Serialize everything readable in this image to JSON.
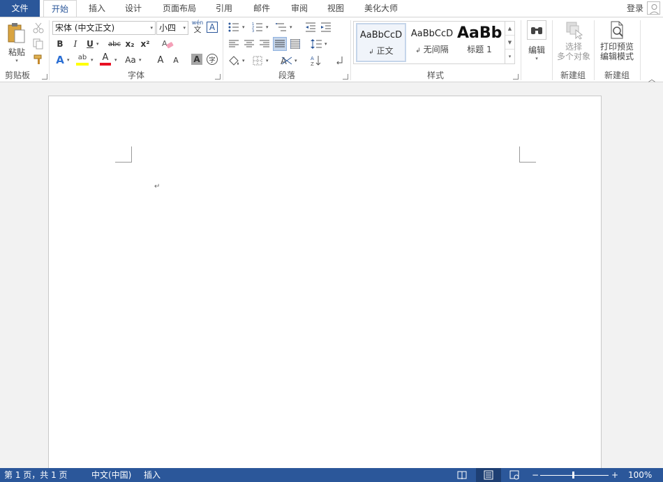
{
  "tabs": {
    "file": "文件",
    "home": "开始",
    "insert": "插入",
    "design": "设计",
    "layout": "页面布局",
    "references": "引用",
    "mailings": "邮件",
    "review": "审阅",
    "view": "视图",
    "beautify": "美化大师"
  },
  "account": {
    "login": "登录"
  },
  "clipboard": {
    "paste": "粘贴",
    "label": "剪贴板"
  },
  "font": {
    "name": "宋体 (中文正文)",
    "size": "小四",
    "pinyin_top": "wén",
    "pinyin_bottom": "文",
    "border_char": "A",
    "bold": "B",
    "italic": "I",
    "underline": "U",
    "strike": "abc",
    "subscript": "x₂",
    "superscript": "x²",
    "text_effect": "A",
    "highlight": "ab",
    "font_color": "A",
    "change_case": "Aa",
    "grow": "A",
    "shrink": "A",
    "shading_char": "A",
    "enclose_char": "字",
    "label": "字体",
    "highlight_color": "#ffff00",
    "font_color_value": "#e81123"
  },
  "paragraph": {
    "label": "段落"
  },
  "styles": {
    "label": "样式",
    "items": [
      {
        "preview": "AaBbCcD",
        "name": "正文",
        "mark": "↲"
      },
      {
        "preview": "AaBbCcD",
        "name": "无间隔",
        "mark": "↲"
      },
      {
        "preview": "AaBb",
        "name": "标题 1",
        "mark": ""
      }
    ]
  },
  "editing": {
    "edit": "编辑"
  },
  "newgroup1": {
    "line1": "选择",
    "line2": "多个对象",
    "label": "新建组"
  },
  "newgroup2": {
    "line1": "打印预览",
    "line2": "编辑模式",
    "label": "新建组"
  },
  "document": {
    "paragraph_mark": "↵"
  },
  "statusbar": {
    "page": "第 1 页，共 1 页",
    "language": "中文(中国)",
    "mode": "插入",
    "zoom": "100%",
    "zoom_minus": "−",
    "zoom_plus": "+"
  },
  "colors": {
    "accent": "#2b579a",
    "ribbon_bg": "#ffffff",
    "doc_bg": "#f2f2f2"
  }
}
